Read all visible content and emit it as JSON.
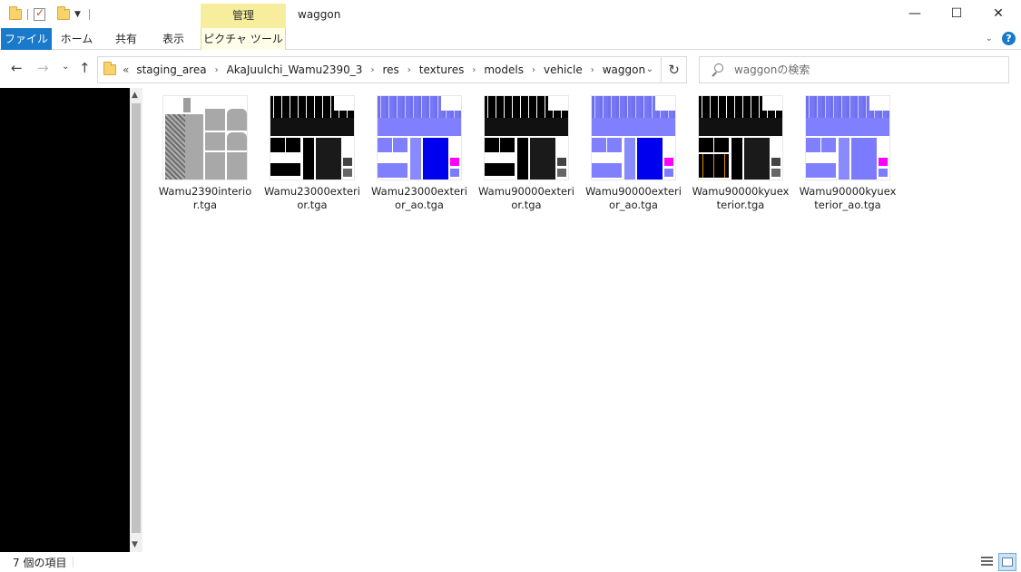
{
  "window": {
    "title": "waggon",
    "context_tab_group": "管理",
    "controls": {
      "minimize": "—",
      "maximize": "☐",
      "close": "✕"
    }
  },
  "ribbon": {
    "tabs": [
      {
        "label": "ファイル"
      },
      {
        "label": "ホーム"
      },
      {
        "label": "共有"
      },
      {
        "label": "表示"
      },
      {
        "label": "ピクチャ ツール"
      }
    ],
    "help": "?",
    "collapse": "⌄"
  },
  "nav": {
    "back": "←",
    "forward": "→",
    "recent": "⌄",
    "up": "↑",
    "overflow": "«",
    "breadcrumbs": [
      "staging_area",
      "AkaJuulchi_Wamu2390_3",
      "res",
      "textures",
      "models",
      "vehicle",
      "waggon"
    ],
    "crumb_separator": "›",
    "dropdown": "⌄",
    "refresh": "↻"
  },
  "search": {
    "placeholder": "waggonの検索"
  },
  "files": [
    {
      "name": "Wamu2390interior.tga",
      "style": "interior"
    },
    {
      "name": "Wamu23000exterior.tga",
      "style": "bw"
    },
    {
      "name": "Wamu23000exterior_ao.tga",
      "style": "blue"
    },
    {
      "name": "Wamu90000exterior.tga",
      "style": "bw"
    },
    {
      "name": "Wamu90000exterior_ao.tga",
      "style": "blue"
    },
    {
      "name": "Wamu90000kyuexterior.tga",
      "style": "bw-orange"
    },
    {
      "name": "Wamu90000kyuexterior_ao.tga",
      "style": "blue"
    }
  ],
  "status": {
    "item_count": "7 個の項目"
  },
  "colors": {
    "accent": "#1979ca",
    "context_tab": "#f6ee9c",
    "ao_blue": "#7b7bff",
    "ao_deep": "#0000ee",
    "magenta": "#ff00ff",
    "orange": "#e08a00"
  }
}
